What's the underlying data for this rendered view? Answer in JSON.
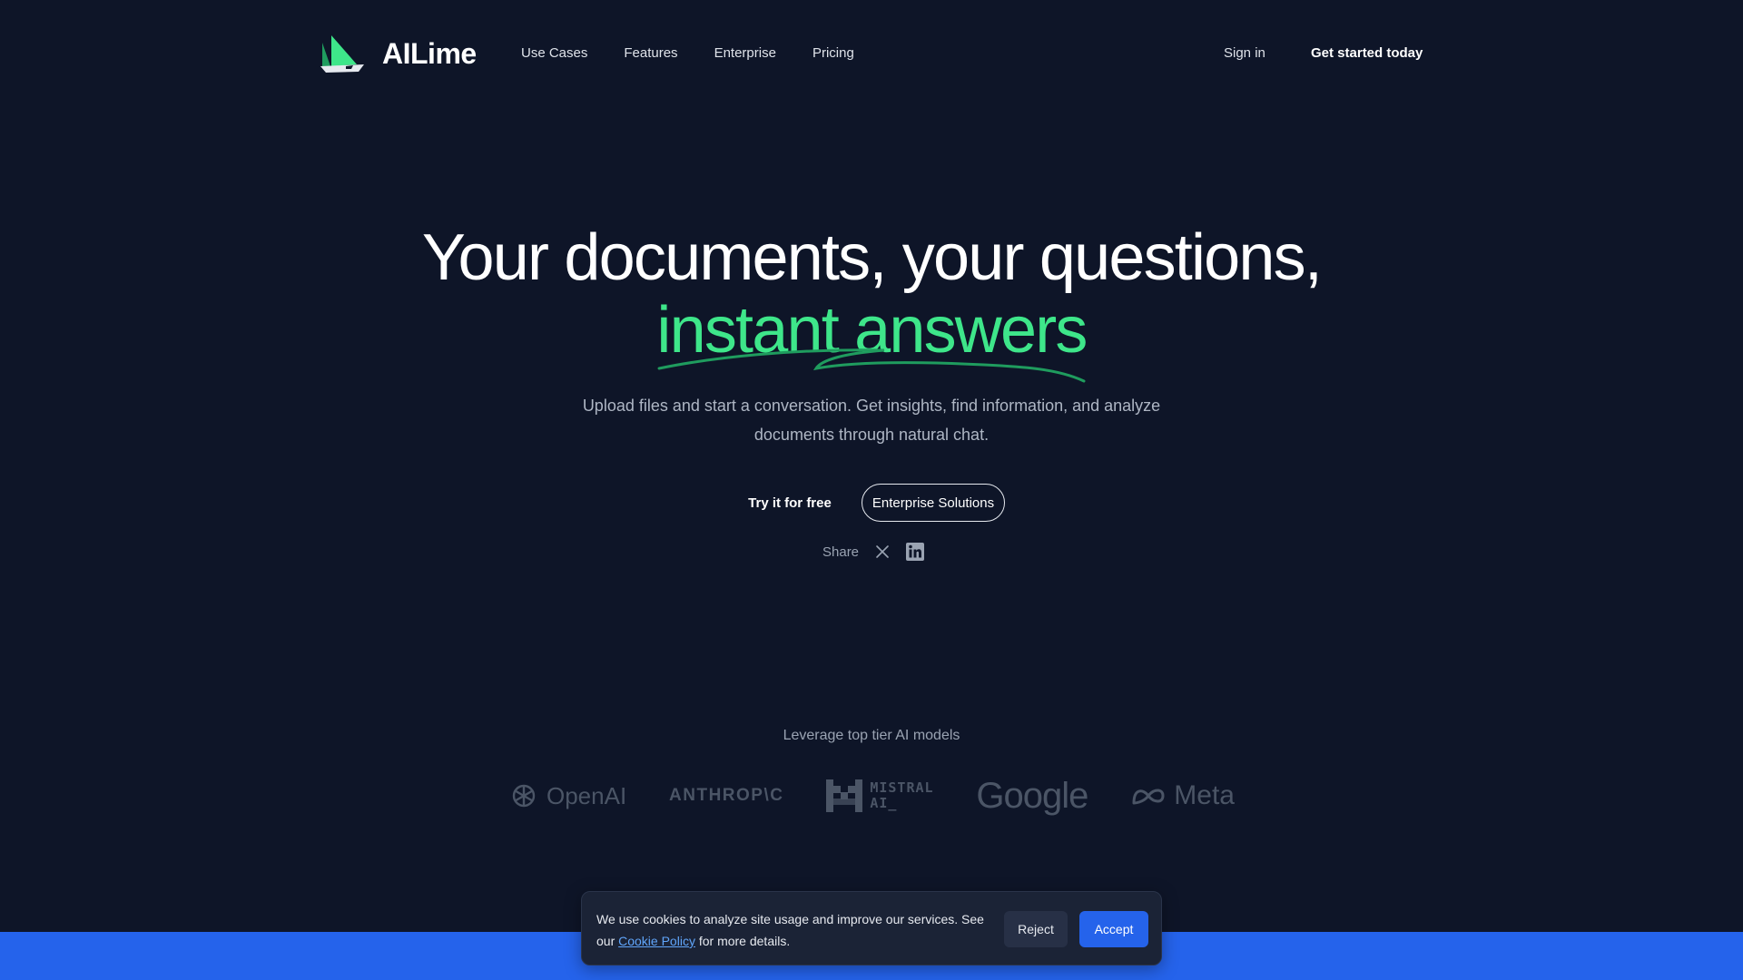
{
  "brand": {
    "name": "AILime",
    "colors": {
      "accent": "#3ee68a",
      "primary": "#2563eb",
      "background": "#0e1528"
    }
  },
  "nav": {
    "items": [
      {
        "label": "Use Cases"
      },
      {
        "label": "Features"
      },
      {
        "label": "Enterprise"
      },
      {
        "label": "Pricing"
      }
    ],
    "sign_in": "Sign in",
    "get_started": "Get started today"
  },
  "hero": {
    "title": "Your documents, your questions,",
    "accent": "instant answers",
    "subtitle": "Upload files and start a conversation. Get insights, find information, and analyze documents through natural chat.",
    "cta_primary": "Try it for free",
    "cta_secondary": "Enterprise Solutions"
  },
  "share": {
    "label": "Share",
    "icons": [
      "x-icon",
      "linkedin-icon"
    ]
  },
  "models": {
    "label": "Leverage top tier AI models",
    "logos": [
      {
        "name": "OpenAI",
        "text": "OpenAI"
      },
      {
        "name": "Anthropic",
        "text": "ANTHROP\\C"
      },
      {
        "name": "Mistral AI",
        "line1": "MISTRAL",
        "line2": "AI_"
      },
      {
        "name": "Google",
        "text": "Google"
      },
      {
        "name": "Meta",
        "text": "Meta"
      }
    ]
  },
  "cookie": {
    "text_before": "We use cookies to analyze site usage and improve our services. See our ",
    "link": "Cookie Policy",
    "text_after": " for more details.",
    "reject": "Reject",
    "accept": "Accept"
  }
}
